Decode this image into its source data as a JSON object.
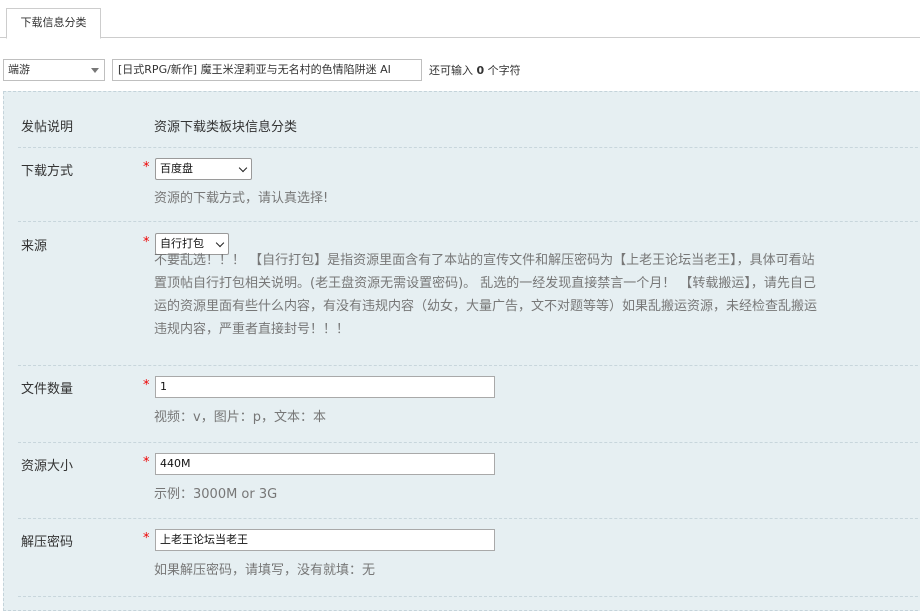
{
  "tabs": [
    {
      "label": "下载信息分类"
    }
  ],
  "subject": {
    "type_value": "端游",
    "title_value": "[日式RPG/新作] 魔王米涅莉亚与无名村的色情陷阱迷 AI",
    "hint_prefix": "还可输入",
    "hint_count": "0",
    "hint_suffix": "个字符"
  },
  "form": {
    "rows": [
      {
        "label": "发帖说明",
        "text": "资源下载类板块信息分类"
      },
      {
        "label": "下载方式",
        "required": "*",
        "value": "百度盘",
        "hint": "资源的下载方式，请认真选择!"
      },
      {
        "label": "来源",
        "required": "*",
        "value": "自行打包",
        "lines": [
          "不要乱选！！！ 【自行打包】是指资源里面含有了本站的宣传文件和解压密码为【上老王论坛当老王】，具体可看站",
          "置顶帖自行打包相关说明。(老王盘资源无需设置密码)。 乱选的一经发现直接禁言一个月！ 【转载搬运】，请先自己",
          "运的资源里面有些什么内容，有没有违规内容（幼女，大量广告，文不对题等等）如果乱搬运资源，未经检查乱搬运",
          "违规内容，严重者直接封号！！！"
        ]
      },
      {
        "label": "文件数量",
        "required": "*",
        "value": "1",
        "hint": "视频：v，图片：p，文本：本"
      },
      {
        "label": "资源大小",
        "required": "*",
        "value": "440M",
        "hint": "示例：3000M or 3G"
      },
      {
        "label": "解压密码",
        "required": "*",
        "value": "上老王论坛当老王",
        "hint": "如果解压密码，请填写，没有就填：无"
      }
    ]
  }
}
